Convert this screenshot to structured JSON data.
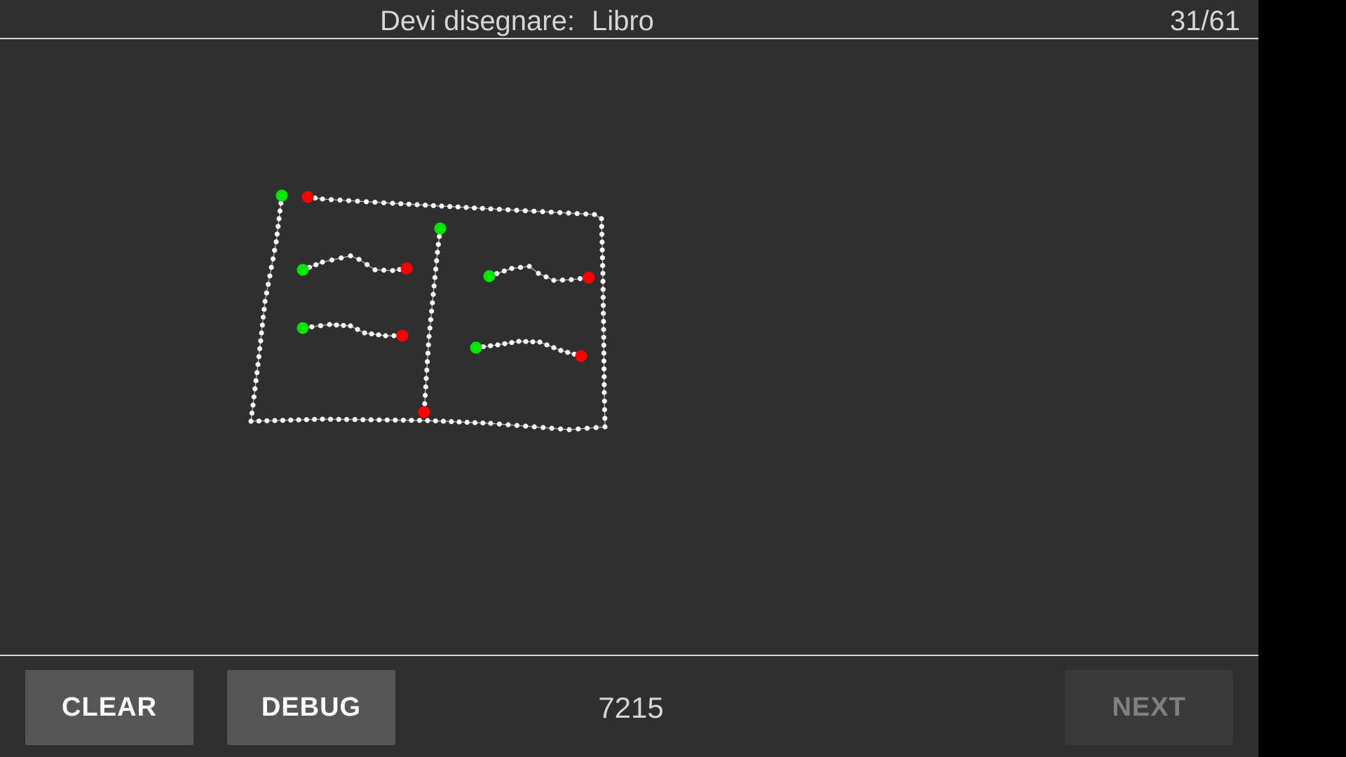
{
  "header": {
    "prompt_label": "Devi disegnare:",
    "prompt_word": "Libro",
    "counter": "31/61"
  },
  "footer": {
    "clear_label": "CLEAR",
    "debug_label": "DEBUG",
    "score": "7215",
    "next_label": "NEXT"
  },
  "colors": {
    "background": "#2f2f2f",
    "stroke": "#ffffff",
    "stroke_start": "#00e600",
    "stroke_end": "#ff0000"
  }
}
